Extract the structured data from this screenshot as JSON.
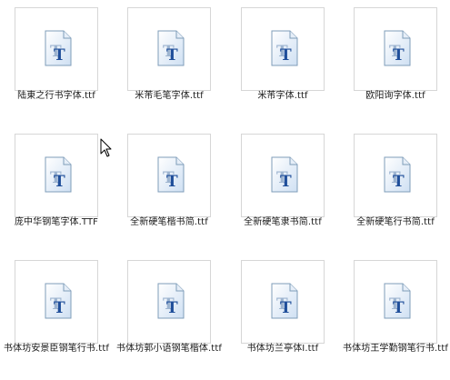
{
  "icon_semantic": "truetype-font-file-icon",
  "files": [
    {
      "name": "陆東之行书字体.ttf"
    },
    {
      "name": "米芾毛笔字体.ttf"
    },
    {
      "name": "米芾字体.ttf"
    },
    {
      "name": "欧阳询字体.ttf"
    },
    {
      "name": "庞中华钢笔字体.TTF"
    },
    {
      "name": "全新硬笔楷书简.ttf"
    },
    {
      "name": "全新硬笔隶书简.ttf"
    },
    {
      "name": "全新硬笔行书简.ttf"
    },
    {
      "name": "书体坊安景臣钢笔行书.ttf"
    },
    {
      "name": "书体坊郭小语钢笔楷体.ttf"
    },
    {
      "name": "书体坊兰亭体I.ttf"
    },
    {
      "name": "书体坊王学勤钢笔行书.ttf"
    }
  ]
}
